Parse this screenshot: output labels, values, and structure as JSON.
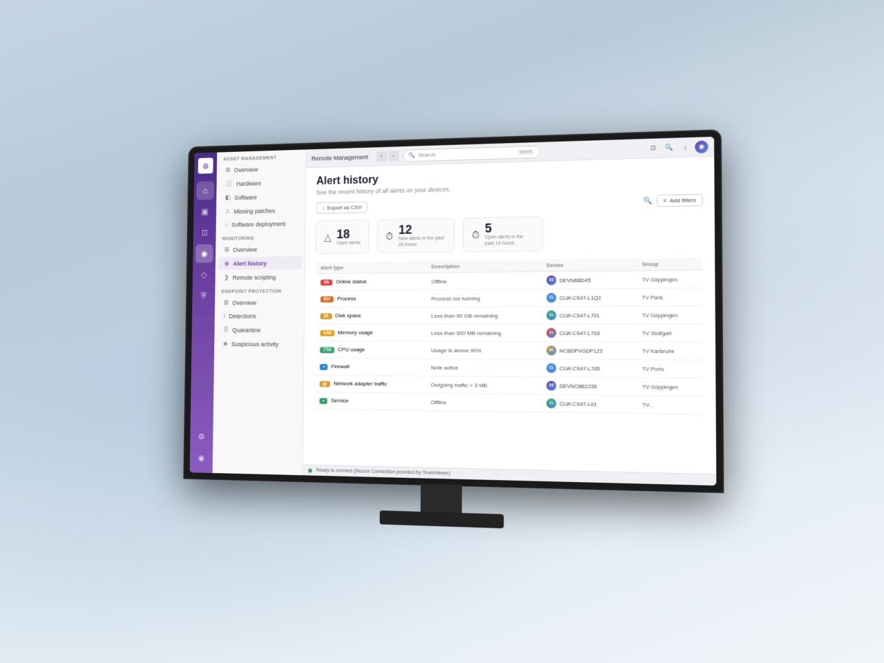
{
  "app": {
    "title": "Remote Management",
    "search_placeholder": "Search",
    "search_shortcut": "Ctrl+S"
  },
  "sidebar": {
    "asset_management": {
      "section_title": "ASSET MANAGEMENT",
      "items": [
        {
          "id": "overview-asset",
          "label": "Overview",
          "icon": "⊞"
        },
        {
          "id": "hardware",
          "label": "Hardware",
          "icon": "⬜"
        },
        {
          "id": "software",
          "label": "Software",
          "icon": "◧"
        },
        {
          "id": "missing-patches",
          "label": "Missing patches",
          "icon": "⚠"
        },
        {
          "id": "software-deployment",
          "label": "Software deployment",
          "icon": "↑"
        }
      ]
    },
    "monitoring": {
      "section_title": "MONITORING",
      "items": [
        {
          "id": "overview-mon",
          "label": "Overview",
          "icon": "⊞"
        },
        {
          "id": "alert-history",
          "label": "Alert history",
          "icon": "◉",
          "active": true
        },
        {
          "id": "remote-scripting",
          "label": "Remote scripting",
          "icon": "❯"
        }
      ]
    },
    "endpoint_protection": {
      "section_title": "ENDPOINT PROTECTION",
      "items": [
        {
          "id": "overview-ep",
          "label": "Overview",
          "icon": "⊞"
        },
        {
          "id": "detections",
          "label": "Detections",
          "icon": "!"
        },
        {
          "id": "quarantine",
          "label": "Quarantine",
          "icon": "☰"
        },
        {
          "id": "suspicious",
          "label": "Suspicious activity",
          "icon": "◈"
        }
      ]
    }
  },
  "page": {
    "title": "Alert history",
    "subtitle": "See the recent history of all alerts on your devices.",
    "export_label": "Export as CSV",
    "add_filters_label": "Add filters",
    "stats": [
      {
        "id": "open-alerts",
        "number": "18",
        "label": "Open alerts",
        "icon": "△"
      },
      {
        "id": "new-alerts",
        "number": "12",
        "label": "New alerts in the past 24 hours",
        "icon": "⏱"
      },
      {
        "id": "open-24h",
        "number": "5",
        "label": "Open alerts in the past 14 hours",
        "icon": "⏱"
      }
    ],
    "table": {
      "columns": [
        "Alert type",
        "Description",
        "Device",
        "Group"
      ],
      "rows": [
        {
          "severity": "bk",
          "severity_class": "sev-critical",
          "type": "Online status",
          "description": "Offline",
          "device": "DEVNB8D45",
          "device_color": "#6b3fa0",
          "group": "TV Göppingen"
        },
        {
          "severity": "Err",
          "severity_class": "sev-high",
          "type": "Process",
          "description": "Process not running",
          "device": "CLW-CS47-L1Q2",
          "device_color": "#4a90d9",
          "group": "TV Paris"
        },
        {
          "severity": "2k",
          "severity_class": "sev-medium",
          "type": "Disk space",
          "description": "Less than 90 GB remaining",
          "device": "CLW-CS47-L701",
          "device_color": "#38a169",
          "group": "TV Göppingen"
        },
        {
          "severity": "14d",
          "severity_class": "sev-warning",
          "type": "Memory usage",
          "description": "Less than 500 MB remaining",
          "device": "CLW-CS47-L703",
          "device_color": "#e53e3e",
          "group": "TV Stuttgart"
        },
        {
          "severity": "77d",
          "severity_class": "sev-low",
          "type": "CPU usage",
          "description": "Usage is above 90%",
          "device": "HCBDPVGDP123",
          "device_color": "#d69e2e",
          "group": "TV Karlsruhe"
        },
        {
          "severity": "",
          "severity_class": "sev-info",
          "type": "Firewall",
          "description": "Note active",
          "device": "CLW-CS47-L705",
          "device_color": "#4a90d9",
          "group": "TV Porto"
        },
        {
          "severity": "jp",
          "severity_class": "sev-medium",
          "type": "Network adapter traffic",
          "description": "Outgoing traffic > 3 MB",
          "device": "DEVNC8B2235",
          "device_color": "#6b3fa0",
          "group": "TV Göppingen"
        },
        {
          "severity": "",
          "severity_class": "sev-low",
          "type": "Service",
          "description": "Offline",
          "device": "CLW-CS47-L01",
          "device_color": "#38a169",
          "group": "TV..."
        }
      ]
    }
  },
  "status_bar": {
    "status_text": "Ready to connect (Secure Connection provided by TeamViewer)",
    "indicator": "connected"
  },
  "icons": {
    "logo": "◎",
    "home": "⌂",
    "monitor": "▣",
    "devices": "⊡",
    "alerts": "◉",
    "shield": "⛨",
    "settings": "⚙",
    "user": "◉",
    "search": "🔍",
    "export": "↓",
    "filter": "≡",
    "back": "‹",
    "forward": "›"
  }
}
